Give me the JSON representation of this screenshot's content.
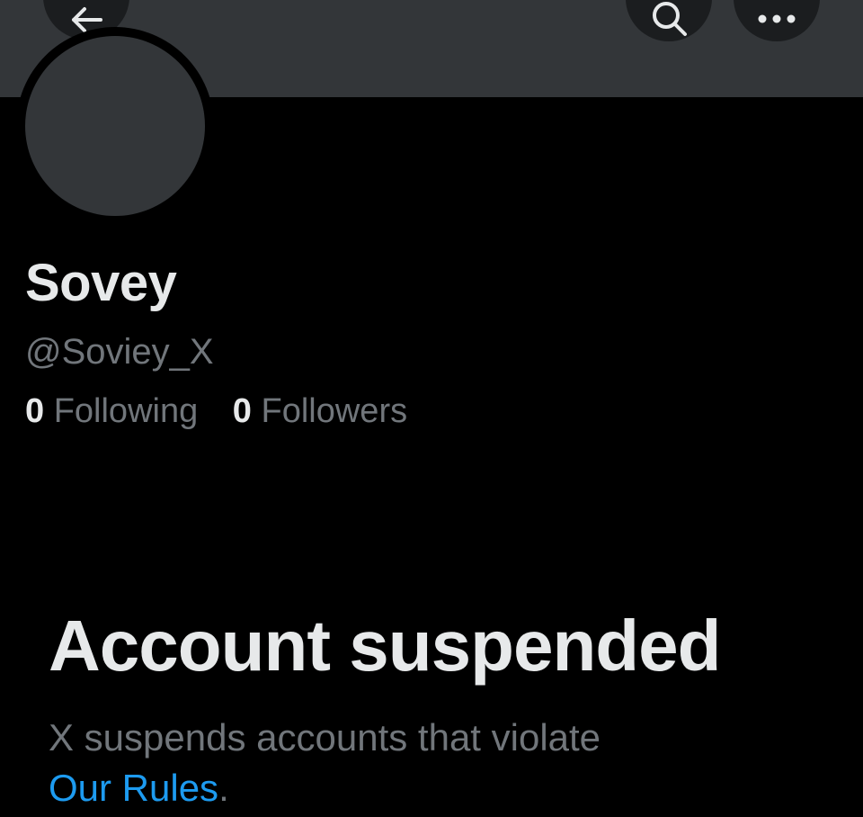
{
  "colors": {
    "background": "#000000",
    "banner": "#333639",
    "avatar": "#333639",
    "primary_text": "#e7e9ea",
    "secondary_text": "#71767b",
    "link": "#1d9bf0"
  },
  "header": {
    "back_icon": "arrow-left-icon",
    "search_icon": "search-icon",
    "more_icon": "more-horizontal-icon"
  },
  "profile": {
    "display_name": "Sovey",
    "handle": "@Soviey_X",
    "following_count": "0",
    "following_label": "Following",
    "followers_count": "0",
    "followers_label": "Followers"
  },
  "suspension": {
    "title": "Account suspended",
    "description": "X suspends accounts that violate",
    "rules_link": "Our Rules",
    "trailing": "."
  }
}
